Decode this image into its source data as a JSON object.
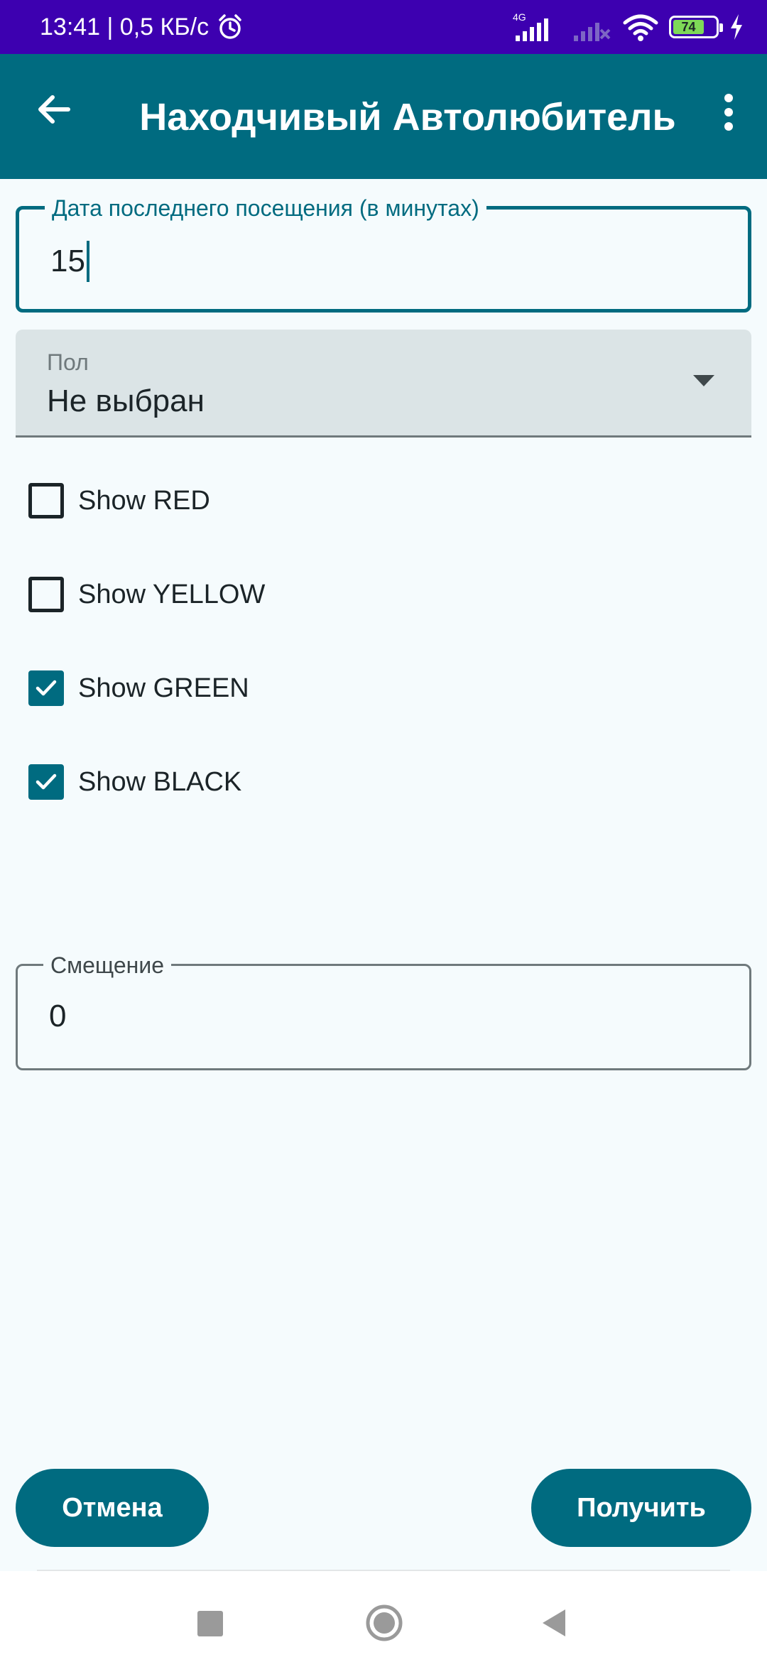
{
  "status_bar": {
    "time_speed": "13:41 | 0,5 КБ/с",
    "network_type": "4G",
    "battery_level": "74",
    "icons": [
      "alarm-icon",
      "signal-icon",
      "signal-weak-icon",
      "wifi-icon",
      "battery-icon",
      "charging-icon"
    ]
  },
  "app_bar": {
    "title": "Находчивый Автолюбитель",
    "back_icon": "arrow-left-icon",
    "menu_icon": "more-vertical-icon"
  },
  "last_visit_field": {
    "label": "Дата последнего посещения (в минутах)",
    "value": "15"
  },
  "gender_dropdown": {
    "label": "Пол",
    "value": "Не выбран"
  },
  "checkboxes": [
    {
      "label": "Show RED",
      "checked": false
    },
    {
      "label": "Show YELLOW",
      "checked": false
    },
    {
      "label": "Show GREEN",
      "checked": true
    },
    {
      "label": "Show BLACK",
      "checked": true
    }
  ],
  "offset_field": {
    "label": "Смещение",
    "value": "0"
  },
  "buttons": {
    "cancel": "Отмена",
    "submit": "Получить"
  },
  "colors": {
    "status_bar": "#3d00b0",
    "primary": "#006b80",
    "background": "#f5fbfd",
    "dropdown_fill": "#dbe4e6"
  }
}
